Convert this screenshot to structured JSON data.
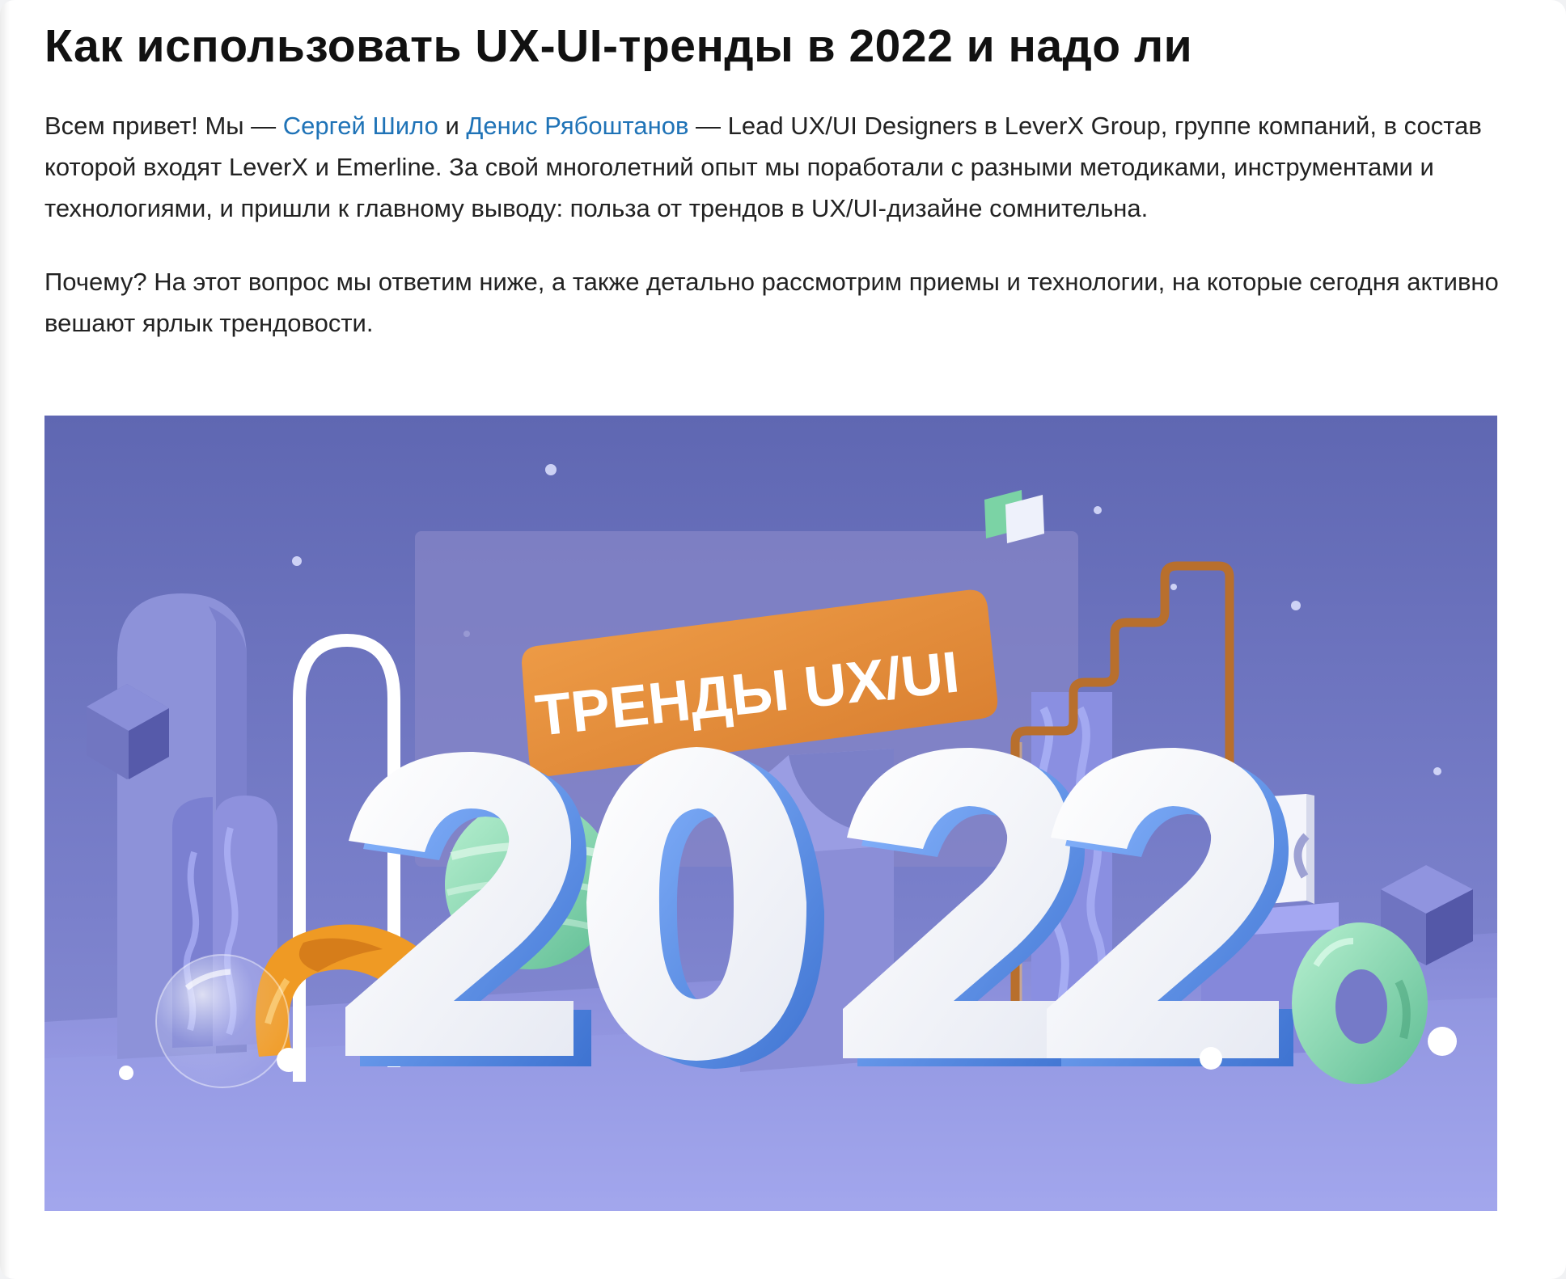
{
  "article": {
    "title": "Как использовать UX-UI-тренды в 2022 и надо ли",
    "intro": {
      "before_author_1": "Всем привет! Мы — ",
      "author_1": "Сергей Шило",
      "between_authors": " и ",
      "author_2": "Денис Рябоштанов",
      "after_author_2": " — Lead UX/UI Designers в LeverX Group, группе компаний, в состав которой входят LeverX и Emerline. За свой многолетний опыт мы поработали с разными методиками, инструментами и технологиями, и пришли к главному выводу: польза от трендов в UX/UI-дизайне сомнительна."
    },
    "second_paragraph": "Почему? На этот вопрос мы ответим ниже, а также детально рассмотрим приемы и технологии, на которые сегодня активно вешают ярлык трендовости.",
    "hero": {
      "badge_text": "ТРЕНДЫ UX/UI",
      "year_digits": [
        "2",
        "0",
        "2",
        "2"
      ]
    }
  },
  "colors": {
    "link": "#1f73b7",
    "text": "#222222",
    "title": "#111111",
    "hero_background": "#6d73c0",
    "badge_orange": "#dd8a3a",
    "digit_face": "#f7f8fb",
    "digit_side": "#4f83de",
    "mint": "#87d1ac",
    "gold": "#b86f2d"
  }
}
